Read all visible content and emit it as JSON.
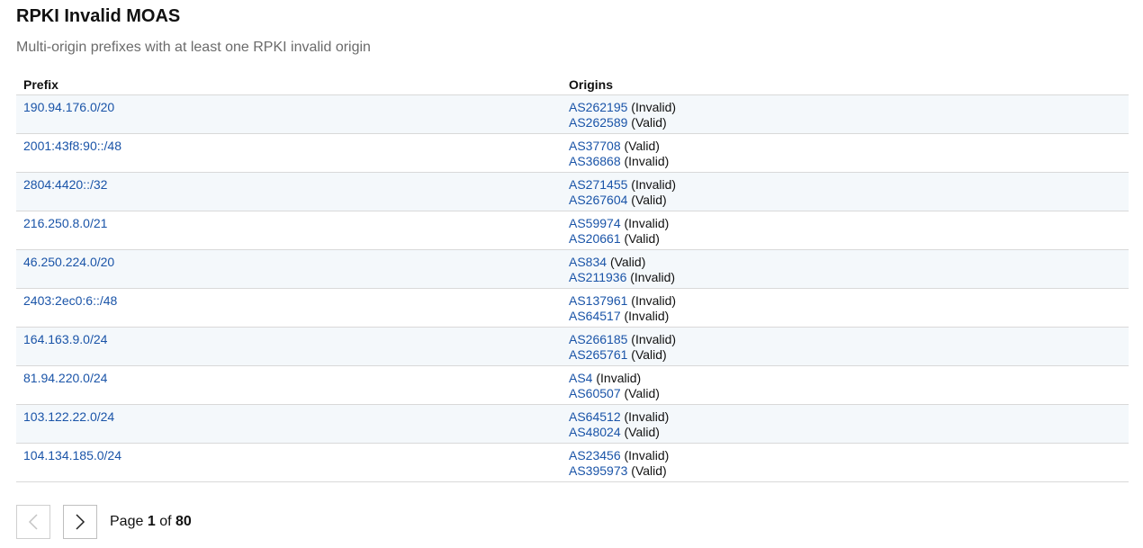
{
  "page": {
    "title": "RPKI Invalid MOAS",
    "subtitle": "Multi-origin prefixes with at least one RPKI invalid origin"
  },
  "table": {
    "columns": {
      "prefix": "Prefix",
      "origins": "Origins"
    },
    "rows": [
      {
        "prefix": "190.94.176.0/20",
        "origins": [
          {
            "asn": "AS262195",
            "status": "(Invalid)"
          },
          {
            "asn": "AS262589",
            "status": "(Valid)"
          }
        ]
      },
      {
        "prefix": "2001:43f8:90::/48",
        "origins": [
          {
            "asn": "AS37708",
            "status": "(Valid)"
          },
          {
            "asn": "AS36868",
            "status": "(Invalid)"
          }
        ]
      },
      {
        "prefix": "2804:4420::/32",
        "origins": [
          {
            "asn": "AS271455",
            "status": "(Invalid)"
          },
          {
            "asn": "AS267604",
            "status": "(Valid)"
          }
        ]
      },
      {
        "prefix": "216.250.8.0/21",
        "origins": [
          {
            "asn": "AS59974",
            "status": "(Invalid)"
          },
          {
            "asn": "AS20661",
            "status": "(Valid)"
          }
        ]
      },
      {
        "prefix": "46.250.224.0/20",
        "origins": [
          {
            "asn": "AS834",
            "status": "(Valid)"
          },
          {
            "asn": "AS211936",
            "status": "(Invalid)"
          }
        ]
      },
      {
        "prefix": "2403:2ec0:6::/48",
        "origins": [
          {
            "asn": "AS137961",
            "status": "(Invalid)"
          },
          {
            "asn": "AS64517",
            "status": "(Invalid)"
          }
        ]
      },
      {
        "prefix": "164.163.9.0/24",
        "origins": [
          {
            "asn": "AS266185",
            "status": "(Invalid)"
          },
          {
            "asn": "AS265761",
            "status": "(Valid)"
          }
        ]
      },
      {
        "prefix": "81.94.220.0/24",
        "origins": [
          {
            "asn": "AS4",
            "status": "(Invalid)"
          },
          {
            "asn": "AS60507",
            "status": "(Valid)"
          }
        ]
      },
      {
        "prefix": "103.122.22.0/24",
        "origins": [
          {
            "asn": "AS64512",
            "status": "(Invalid)"
          },
          {
            "asn": "AS48024",
            "status": "(Valid)"
          }
        ]
      },
      {
        "prefix": "104.134.185.0/24",
        "origins": [
          {
            "asn": "AS23456",
            "status": "(Invalid)"
          },
          {
            "asn": "AS395973",
            "status": "(Valid)"
          }
        ]
      }
    ]
  },
  "pagination": {
    "prev_icon": "chevron-left-icon",
    "next_icon": "chevron-right-icon",
    "prev_disabled": true,
    "label_page": "Page",
    "current": "1",
    "label_of": "of",
    "total": "80"
  },
  "colors": {
    "link": "#1a54a8",
    "row_stripe": "#f4f8fb",
    "border": "#d9d9d9"
  }
}
